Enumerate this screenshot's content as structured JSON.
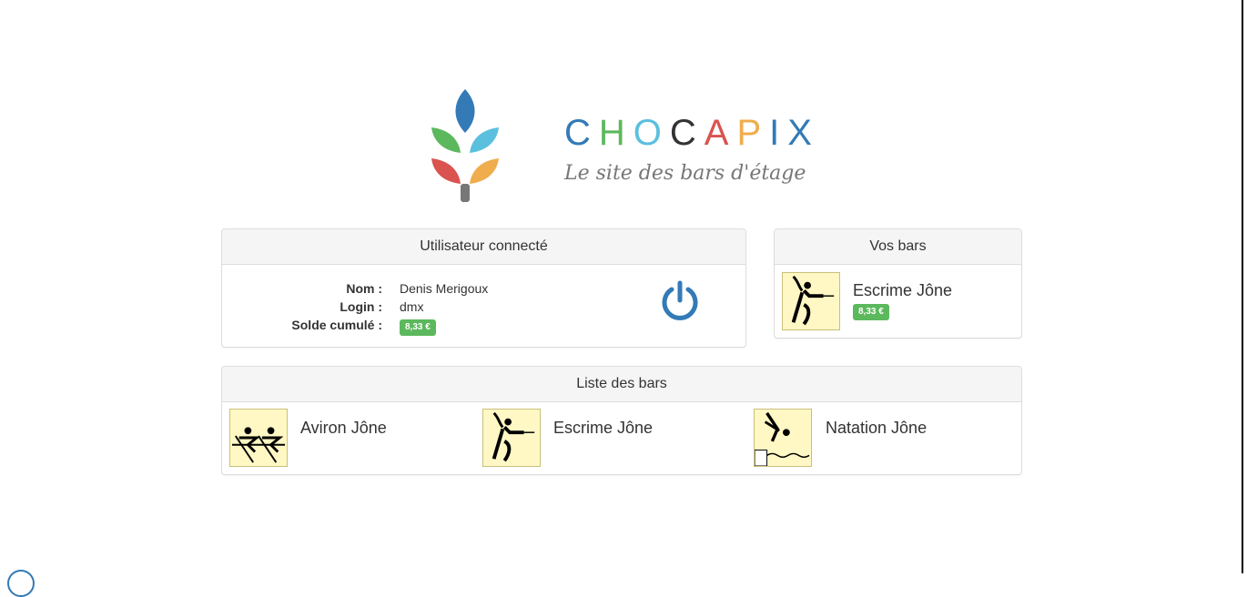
{
  "brand": {
    "letters": [
      {
        "char": "C",
        "color": "#337ab7"
      },
      {
        "char": "H",
        "color": "#5cb85c"
      },
      {
        "char": "O",
        "color": "#5bc0de"
      },
      {
        "char": "C",
        "color": "#333333"
      },
      {
        "char": "A",
        "color": "#d9534f"
      },
      {
        "char": "P",
        "color": "#f0ad4e"
      },
      {
        "char": "I",
        "color": "#337ab7"
      },
      {
        "char": "X",
        "color": "#337ab7"
      }
    ],
    "tagline": "Le site des bars d'étage"
  },
  "user_panel": {
    "title": "Utilisateur connecté",
    "rows": [
      {
        "label": "Nom :",
        "value": "Denis Merigoux"
      },
      {
        "label": "Login :",
        "value": "dmx"
      },
      {
        "label": "Solde cumulé :",
        "value": "8,33 €"
      }
    ],
    "logout_icon": "power-icon"
  },
  "vos_bars": {
    "title": "Vos bars",
    "items": [
      {
        "name": "Escrime Jône",
        "balance": "8,33 €",
        "icon": "fencing-icon"
      }
    ]
  },
  "liste_bars": {
    "title": "Liste des bars",
    "items": [
      {
        "name": "Aviron Jône",
        "icon": "rowing-icon"
      },
      {
        "name": "Escrime Jône",
        "icon": "fencing-icon"
      },
      {
        "name": "Natation Jône",
        "icon": "swimming-icon"
      }
    ]
  },
  "colors": {
    "badge": "#5cb85c",
    "accent": "#337ab7",
    "icon_bg": "#fff8c4"
  }
}
